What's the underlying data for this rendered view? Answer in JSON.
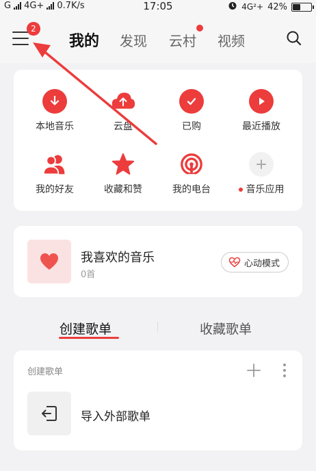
{
  "status_bar": {
    "left": [
      "G",
      "4G+",
      "0.7K/s"
    ],
    "time": "17:05",
    "network": "4G²+",
    "battery": "42%",
    "battery_level": 0.42
  },
  "header": {
    "menu_badge": "2",
    "tabs": [
      {
        "label": "我的",
        "active": true
      },
      {
        "label": "发现",
        "active": false
      },
      {
        "label": "云村",
        "active": false,
        "dot": true
      },
      {
        "label": "视频",
        "active": false
      }
    ]
  },
  "quick_actions": [
    {
      "label": "本地音乐",
      "icon": "download-icon"
    },
    {
      "label": "云盘",
      "icon": "cloud-upload-icon"
    },
    {
      "label": "已购",
      "icon": "check-icon"
    },
    {
      "label": "最近播放",
      "icon": "play-icon"
    },
    {
      "label": "我的好友",
      "icon": "friends-icon"
    },
    {
      "label": "收藏和赞",
      "icon": "star-icon"
    },
    {
      "label": "我的电台",
      "icon": "radio-icon"
    },
    {
      "label": "音乐应用",
      "icon": "plus-icon",
      "dot": true
    }
  ],
  "favorites": {
    "title": "我喜欢的音乐",
    "count": "0首",
    "mode_button": "心动模式"
  },
  "playlist_tabs": [
    "创建歌单",
    "收藏歌单"
  ],
  "created_playlists": {
    "header": "创建歌单",
    "import_label": "导入外部歌单"
  },
  "colors": {
    "accent": "#ec3c3c",
    "background": "#f2f2f4"
  }
}
